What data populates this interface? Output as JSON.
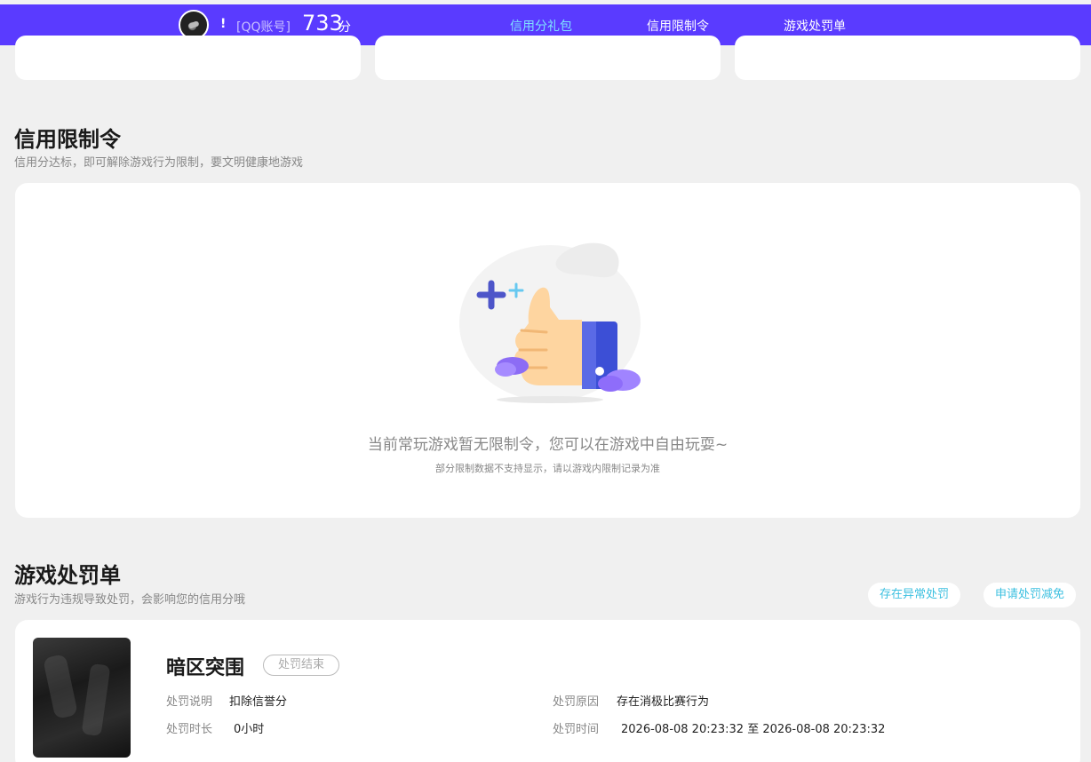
{
  "header": {
    "nickname": "!",
    "account_type": "[QQ账号]",
    "score": "733",
    "score_unit": "分",
    "tabs": [
      {
        "label": "信用分礼包",
        "active": true
      },
      {
        "label": "信用限制令",
        "active": false
      },
      {
        "label": "游戏处罚单",
        "active": false
      }
    ]
  },
  "restriction": {
    "title": "信用限制令",
    "subtitle": "信用分达标，即可解除游戏行为限制，要文明健康地游戏",
    "empty_text": "当前常玩游戏暂无限制令，您可以在游戏中自由玩耍~",
    "empty_note": "部分限制数据不支持显示，请以游戏内限制记录为准"
  },
  "penalty": {
    "title": "游戏处罚单",
    "subtitle": "游戏行为违规导致处罚，会影响您的信用分哦",
    "btn_abnormal": "存在异常处罚",
    "btn_reduce": "申请处罚减免",
    "record": {
      "game": "暗区突围",
      "status": "处罚结束",
      "desc_label": "处罚说明",
      "desc_value": "扣除信誉分",
      "duration_label": "处罚时长",
      "duration_value": "0小时",
      "reason_label": "处罚原因",
      "reason_value": "存在消极比赛行为",
      "time_label": "处罚时间",
      "time_value": "2026-08-08 20:23:32 至 2026-08-08 20:23:32"
    }
  },
  "colors": {
    "brand": "#5a3bff",
    "accent": "#3cc0e0"
  }
}
